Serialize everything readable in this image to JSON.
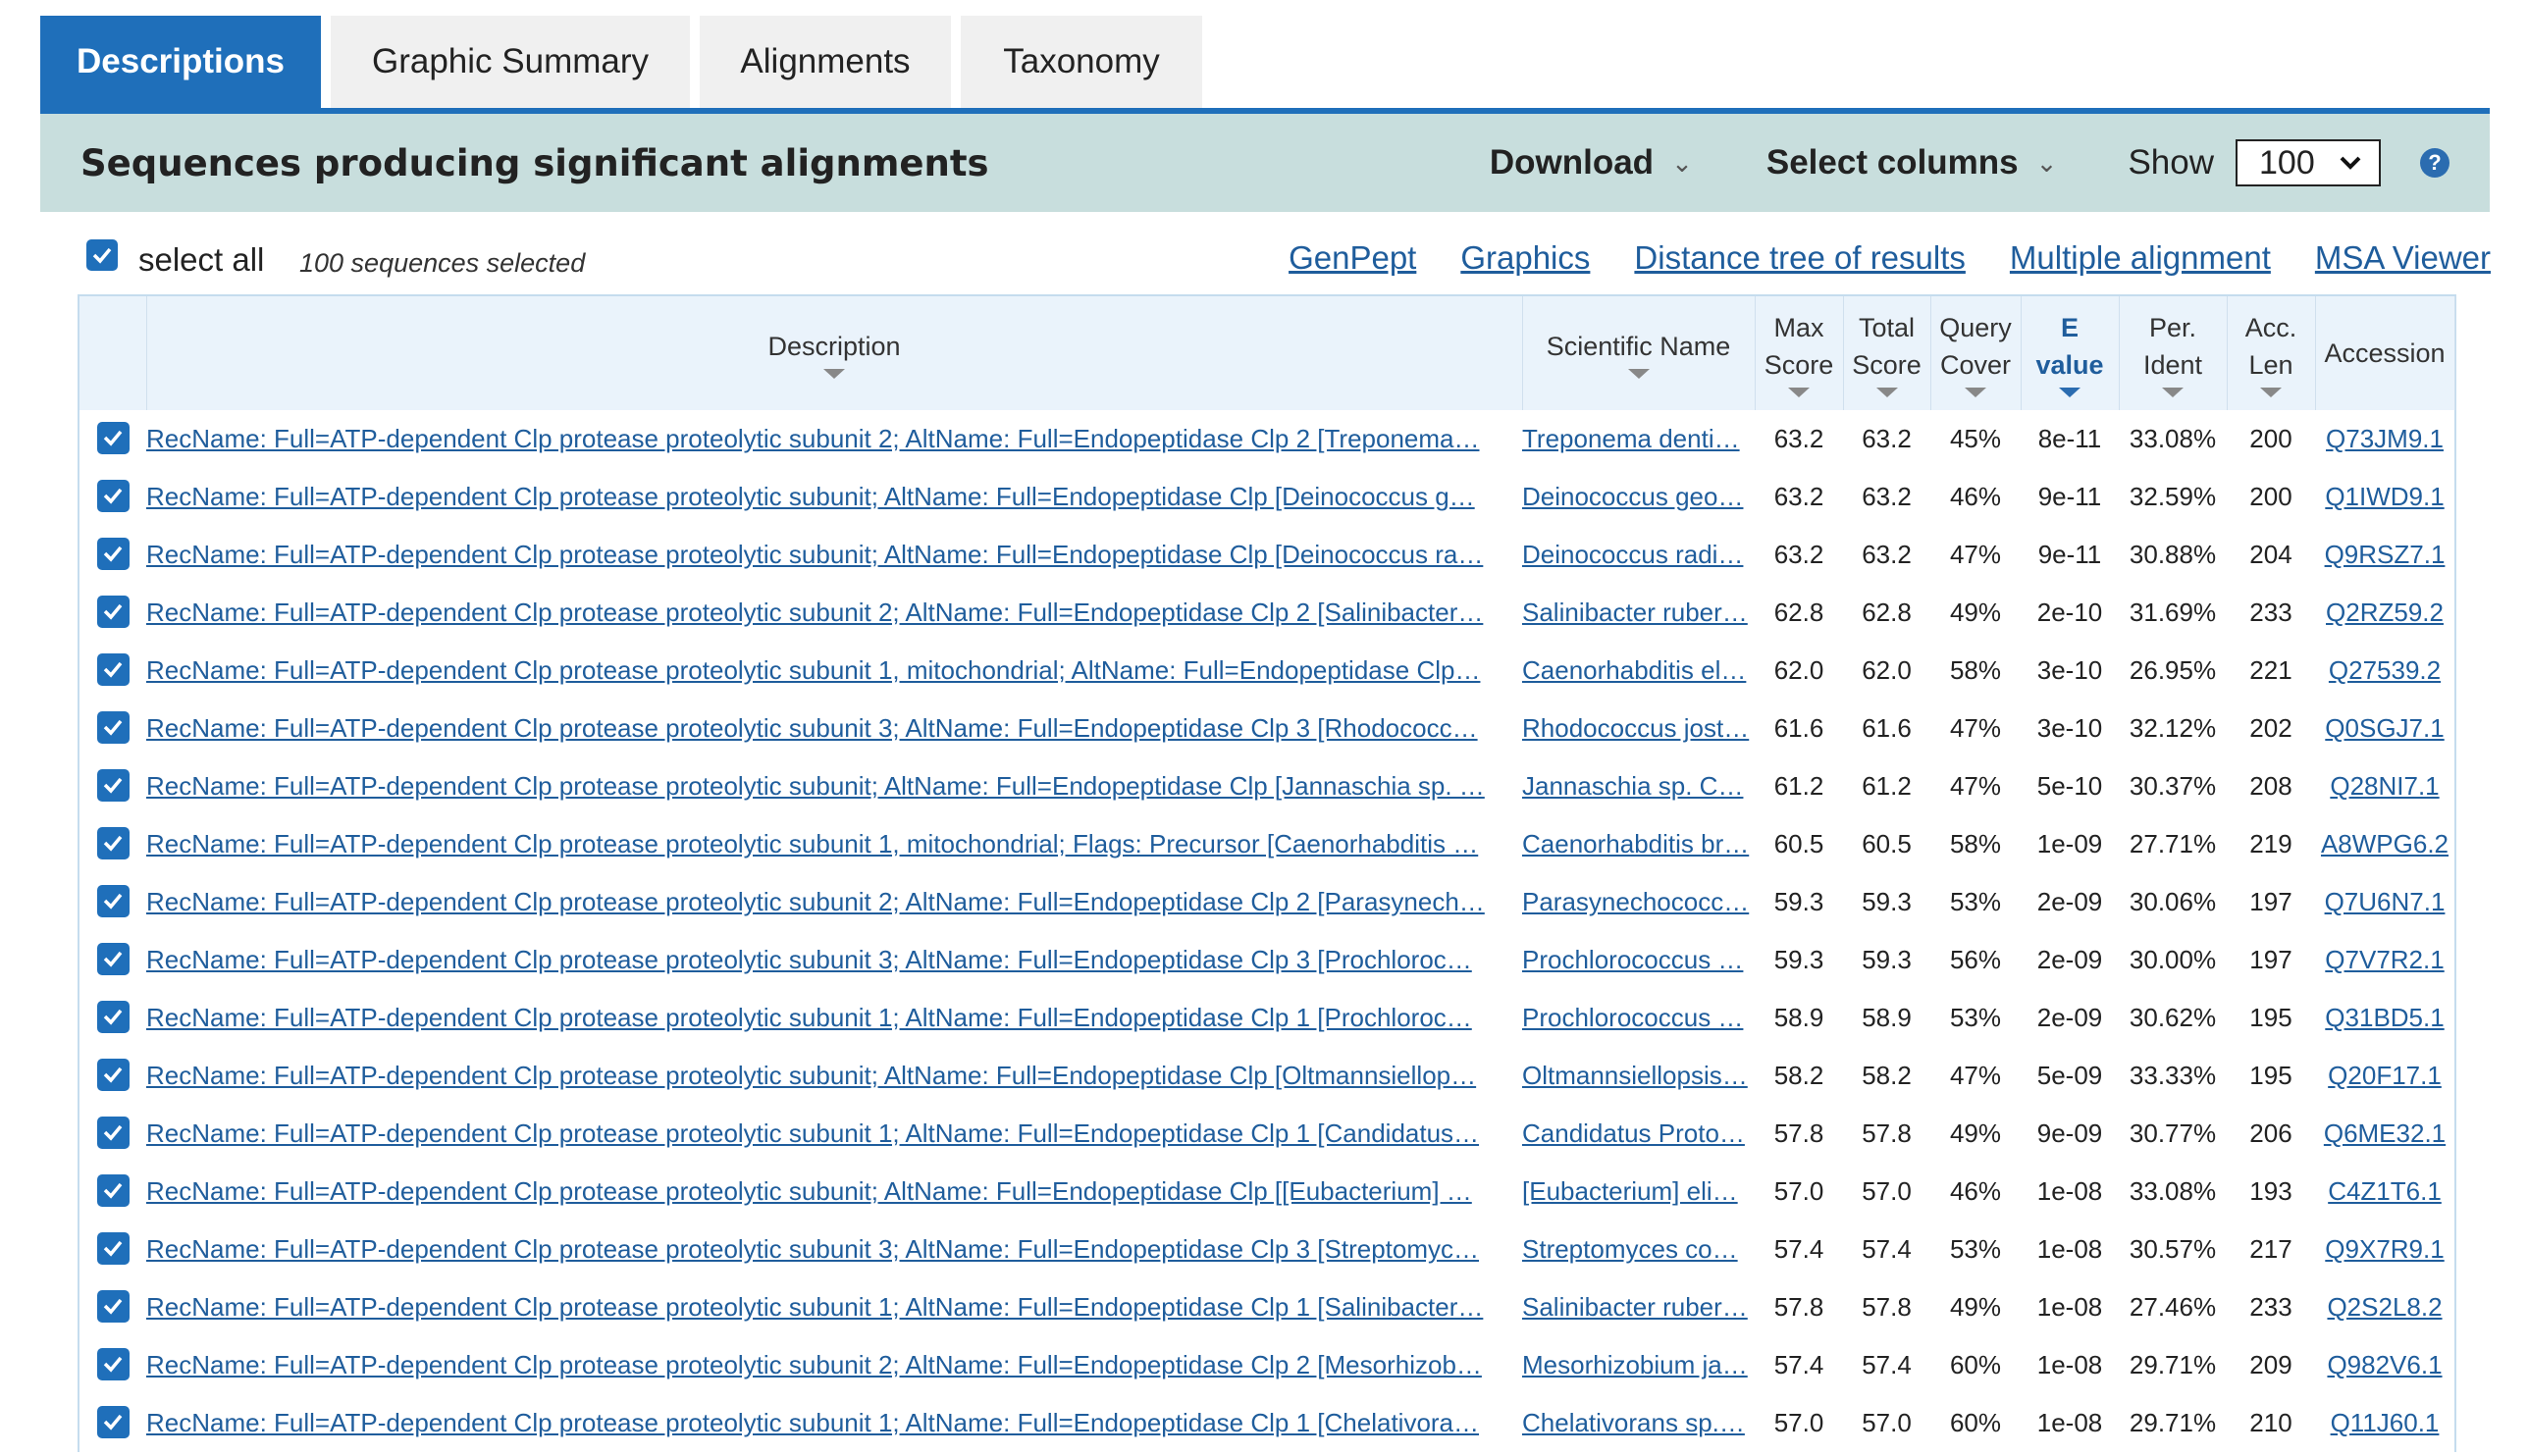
{
  "tabs": [
    {
      "label": "Descriptions",
      "active": true
    },
    {
      "label": "Graphic Summary",
      "active": false
    },
    {
      "label": "Alignments",
      "active": false
    },
    {
      "label": "Taxonomy",
      "active": false
    }
  ],
  "toolbar": {
    "title": "Sequences producing significant alignments",
    "download_label": "Download",
    "select_columns_label": "Select columns",
    "show_label": "Show",
    "show_value": "100",
    "help": "?"
  },
  "selection": {
    "select_all_label": "select all",
    "count_text": "100 sequences selected"
  },
  "links": [
    "GenPept",
    "Graphics",
    "Distance tree of results",
    "Multiple alignment",
    "MSA Viewer"
  ],
  "columns": {
    "description": "Description",
    "scientific_name": "Scientific Name",
    "max_score": [
      "Max",
      "Score"
    ],
    "total_score": [
      "Total",
      "Score"
    ],
    "query_cover": [
      "Query",
      "Cover"
    ],
    "e_value": [
      "E",
      "value"
    ],
    "per_ident": [
      "Per.",
      "Ident"
    ],
    "acc_len": [
      "Acc.",
      "Len"
    ],
    "accession": "Accession"
  },
  "colors": {
    "accent": "#1f6fba",
    "toolbar_bg": "#c8dedd",
    "link": "#1f5d9c",
    "header_bg": "#eaf3fb"
  },
  "rows": [
    {
      "desc": "RecName: Full=ATP-dependent Clp protease proteolytic subunit 2; AltName: Full=Endopeptidase Clp 2 [Treponema…",
      "sci": "Treponema denti…",
      "max": "63.2",
      "total": "63.2",
      "cover": "45%",
      "evalue": "8e-11",
      "ident": "33.08%",
      "len": "200",
      "acc": "Q73JM9.1"
    },
    {
      "desc": "RecName: Full=ATP-dependent Clp protease proteolytic subunit; AltName: Full=Endopeptidase Clp [Deinococcus g…",
      "sci": "Deinococcus geo…",
      "max": "63.2",
      "total": "63.2",
      "cover": "46%",
      "evalue": "9e-11",
      "ident": "32.59%",
      "len": "200",
      "acc": "Q1IWD9.1"
    },
    {
      "desc": "RecName: Full=ATP-dependent Clp protease proteolytic subunit; AltName: Full=Endopeptidase Clp [Deinococcus ra…",
      "sci": "Deinococcus radi…",
      "max": "63.2",
      "total": "63.2",
      "cover": "47%",
      "evalue": "9e-11",
      "ident": "30.88%",
      "len": "204",
      "acc": "Q9RSZ7.1"
    },
    {
      "desc": "RecName: Full=ATP-dependent Clp protease proteolytic subunit 2; AltName: Full=Endopeptidase Clp 2 [Salinibacter…",
      "sci": "Salinibacter ruber…",
      "max": "62.8",
      "total": "62.8",
      "cover": "49%",
      "evalue": "2e-10",
      "ident": "31.69%",
      "len": "233",
      "acc": "Q2RZ59.2"
    },
    {
      "desc": "RecName: Full=ATP-dependent Clp protease proteolytic subunit 1, mitochondrial; AltName: Full=Endopeptidase Clp…",
      "sci": "Caenorhabditis el…",
      "max": "62.0",
      "total": "62.0",
      "cover": "58%",
      "evalue": "3e-10",
      "ident": "26.95%",
      "len": "221",
      "acc": "Q27539.2"
    },
    {
      "desc": "RecName: Full=ATP-dependent Clp protease proteolytic subunit 3; AltName: Full=Endopeptidase Clp 3 [Rhodococc…",
      "sci": "Rhodococcus jost…",
      "max": "61.6",
      "total": "61.6",
      "cover": "47%",
      "evalue": "3e-10",
      "ident": "32.12%",
      "len": "202",
      "acc": "Q0SGJ7.1"
    },
    {
      "desc": "RecName: Full=ATP-dependent Clp protease proteolytic subunit; AltName: Full=Endopeptidase Clp [Jannaschia sp. …",
      "sci": "Jannaschia sp. C…",
      "max": "61.2",
      "total": "61.2",
      "cover": "47%",
      "evalue": "5e-10",
      "ident": "30.37%",
      "len": "208",
      "acc": "Q28NI7.1"
    },
    {
      "desc": "RecName: Full=ATP-dependent Clp protease proteolytic subunit 1, mitochondrial; Flags: Precursor [Caenorhabditis …",
      "sci": "Caenorhabditis br…",
      "max": "60.5",
      "total": "60.5",
      "cover": "58%",
      "evalue": "1e-09",
      "ident": "27.71%",
      "len": "219",
      "acc": "A8WPG6.2"
    },
    {
      "desc": "RecName: Full=ATP-dependent Clp protease proteolytic subunit 2; AltName: Full=Endopeptidase Clp 2 [Parasynech…",
      "sci": "Parasynechococc…",
      "max": "59.3",
      "total": "59.3",
      "cover": "53%",
      "evalue": "2e-09",
      "ident": "30.06%",
      "len": "197",
      "acc": "Q7U6N7.1"
    },
    {
      "desc": "RecName: Full=ATP-dependent Clp protease proteolytic subunit 3; AltName: Full=Endopeptidase Clp 3 [Prochloroc…",
      "sci": "Prochlorococcus …",
      "max": "59.3",
      "total": "59.3",
      "cover": "56%",
      "evalue": "2e-09",
      "ident": "30.00%",
      "len": "197",
      "acc": "Q7V7R2.1"
    },
    {
      "desc": "RecName: Full=ATP-dependent Clp protease proteolytic subunit 1; AltName: Full=Endopeptidase Clp 1 [Prochloroc…",
      "sci": "Prochlorococcus …",
      "max": "58.9",
      "total": "58.9",
      "cover": "53%",
      "evalue": "2e-09",
      "ident": "30.62%",
      "len": "195",
      "acc": "Q31BD5.1"
    },
    {
      "desc": "RecName: Full=ATP-dependent Clp protease proteolytic subunit; AltName: Full=Endopeptidase Clp [Oltmannsiellop…",
      "sci": "Oltmannsiellopsis…",
      "max": "58.2",
      "total": "58.2",
      "cover": "47%",
      "evalue": "5e-09",
      "ident": "33.33%",
      "len": "195",
      "acc": "Q20F17.1"
    },
    {
      "desc": "RecName: Full=ATP-dependent Clp protease proteolytic subunit 1; AltName: Full=Endopeptidase Clp 1 [Candidatus…",
      "sci": "Candidatus Proto…",
      "max": "57.8",
      "total": "57.8",
      "cover": "49%",
      "evalue": "9e-09",
      "ident": "30.77%",
      "len": "206",
      "acc": "Q6ME32.1"
    },
    {
      "desc": "RecName: Full=ATP-dependent Clp protease proteolytic subunit; AltName: Full=Endopeptidase Clp [[Eubacterium] …",
      "sci": "[Eubacterium] eli…",
      "max": "57.0",
      "total": "57.0",
      "cover": "46%",
      "evalue": "1e-08",
      "ident": "33.08%",
      "len": "193",
      "acc": "C4Z1T6.1"
    },
    {
      "desc": "RecName: Full=ATP-dependent Clp protease proteolytic subunit 3; AltName: Full=Endopeptidase Clp 3 [Streptomyc…",
      "sci": "Streptomyces co…",
      "max": "57.4",
      "total": "57.4",
      "cover": "53%",
      "evalue": "1e-08",
      "ident": "30.57%",
      "len": "217",
      "acc": "Q9X7R9.1"
    },
    {
      "desc": "RecName: Full=ATP-dependent Clp protease proteolytic subunit 1; AltName: Full=Endopeptidase Clp 1 [Salinibacter…",
      "sci": "Salinibacter ruber…",
      "max": "57.8",
      "total": "57.8",
      "cover": "49%",
      "evalue": "1e-08",
      "ident": "27.46%",
      "len": "233",
      "acc": "Q2S2L8.2"
    },
    {
      "desc": "RecName: Full=ATP-dependent Clp protease proteolytic subunit 2; AltName: Full=Endopeptidase Clp 2 [Mesorhizob…",
      "sci": "Mesorhizobium ja…",
      "max": "57.4",
      "total": "57.4",
      "cover": "60%",
      "evalue": "1e-08",
      "ident": "29.71%",
      "len": "209",
      "acc": "Q982V6.1"
    },
    {
      "desc": "RecName: Full=ATP-dependent Clp protease proteolytic subunit 1; AltName: Full=Endopeptidase Clp 1 [Chelativora…",
      "sci": "Chelativorans sp.…",
      "max": "57.0",
      "total": "57.0",
      "cover": "60%",
      "evalue": "1e-08",
      "ident": "29.71%",
      "len": "210",
      "acc": "Q11J60.1"
    }
  ]
}
